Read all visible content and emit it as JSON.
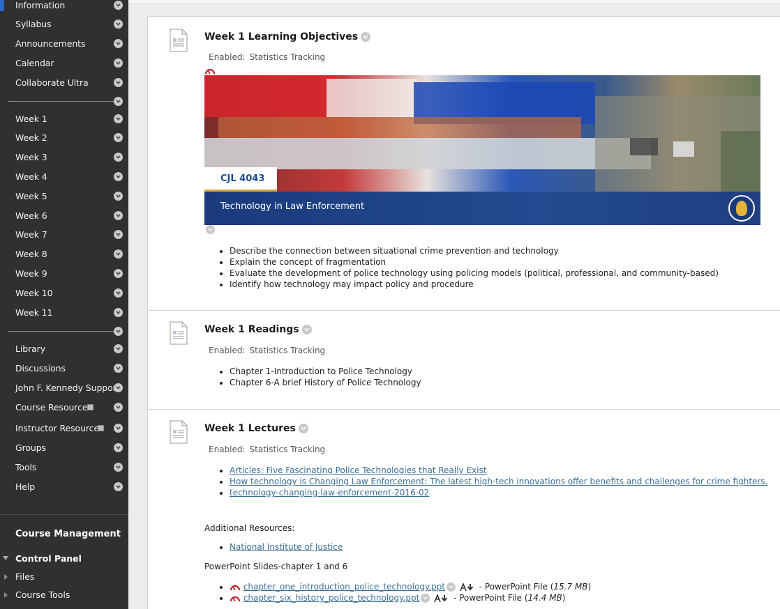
{
  "sidebar": {
    "top_items": [
      "Information",
      "Syllabus",
      "Announcements",
      "Calendar",
      "Collaborate Ultra"
    ],
    "week_items": [
      "Week 1",
      "Week 2",
      "Week 3",
      "Week 4",
      "Week 5",
      "Week 6",
      "Week 7",
      "Week 8",
      "Week 9",
      "Week 10",
      "Week 11"
    ],
    "resource_items": [
      "Library",
      "Discussions",
      "John F. Kennedy Support",
      "Course Resources",
      "Instructor Resources",
      "Groups",
      "Tools",
      "Help"
    ],
    "course_management": "Course Management",
    "control_panel": "Control Panel",
    "control_panel_items": [
      "Files",
      "Course Tools"
    ]
  },
  "items": {
    "objectives": {
      "title": "Week 1 Learning Objectives",
      "enabled_label": "Enabled:",
      "enabled_value": "Statistics Tracking",
      "banner_code": "CJL 4043",
      "banner_subtitle": "Technology in Law Enforcement",
      "bullets": [
        "Describe the connection between situational crime prevention and technology",
        "Explain the concept of fragmentation",
        "Evaluate the development of police technology using policing models (political, professional, and community-based)",
        "Identify how technology may impact policy and procedure"
      ]
    },
    "readings": {
      "title": "Week 1 Readings",
      "enabled_label": "Enabled:",
      "enabled_value": "Statistics Tracking",
      "bullets": [
        "Chapter 1-Introduction to Police Technology",
        "Chapter 6-A brief History of Police Technology"
      ]
    },
    "lectures": {
      "title": "Week 1 Lectures",
      "enabled_label": "Enabled:",
      "enabled_value": "Statistics Tracking",
      "links": [
        "Articles: Five Fascinating Police Technologies that Really Exist",
        "How technology is Changing Law Enforcement: The latest high-tech innovations offer benefits and challenges for crime fighters.",
        "technology-changing-law-enforcement-2016-02"
      ],
      "additional_label": "Additional Resources:",
      "additional_links": [
        "National Institute of Justice"
      ],
      "slides_label": "PowerPoint Slides-chapter 1 and 6",
      "files": [
        {
          "name": "chapter_one_introduction_police_technology.ppt",
          "type": "- PowerPoint File (",
          "size": "15.7 MB",
          "close": ")"
        },
        {
          "name": "chapter_six_history_police_technology.ppt",
          "type": "- PowerPoint File (",
          "size": "14.4 MB",
          "close": ")"
        }
      ]
    }
  },
  "colors": {
    "sidebar_bg": "#303030",
    "link": "#3a6e94",
    "banner_blue": "#1a3a7c",
    "banner_gold": "#d6a72a",
    "tracking_red": "#c0272d"
  }
}
